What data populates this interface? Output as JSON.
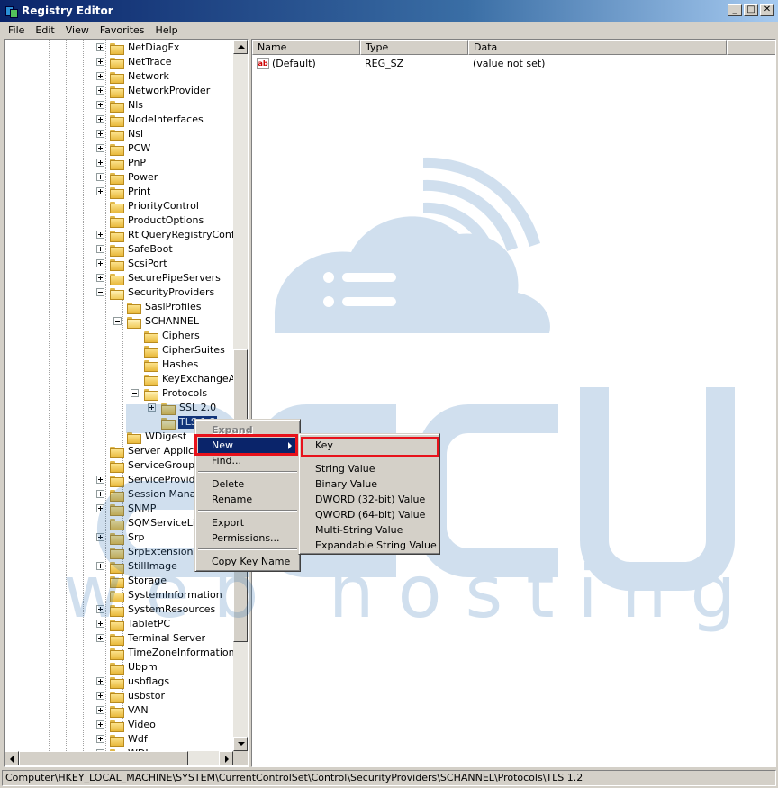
{
  "window": {
    "title": "Registry Editor",
    "minimize": "_",
    "maximize": "□",
    "close": "✕"
  },
  "menu": [
    "File",
    "Edit",
    "View",
    "Favorites",
    "Help"
  ],
  "tree": {
    "nodes": [
      {
        "label": "NetDiagFx",
        "level": 0,
        "expander": "plus"
      },
      {
        "label": "NetTrace",
        "level": 0,
        "expander": "plus"
      },
      {
        "label": "Network",
        "level": 0,
        "expander": "plus"
      },
      {
        "label": "NetworkProvider",
        "level": 0,
        "expander": "plus"
      },
      {
        "label": "Nls",
        "level": 0,
        "expander": "plus"
      },
      {
        "label": "NodeInterfaces",
        "level": 0,
        "expander": "plus"
      },
      {
        "label": "Nsi",
        "level": 0,
        "expander": "plus"
      },
      {
        "label": "PCW",
        "level": 0,
        "expander": "plus"
      },
      {
        "label": "PnP",
        "level": 0,
        "expander": "plus"
      },
      {
        "label": "Power",
        "level": 0,
        "expander": "plus"
      },
      {
        "label": "Print",
        "level": 0,
        "expander": "plus"
      },
      {
        "label": "PriorityControl",
        "level": 0,
        "expander": "none"
      },
      {
        "label": "ProductOptions",
        "level": 0,
        "expander": "none"
      },
      {
        "label": "RtlQueryRegistryConfig",
        "level": 0,
        "expander": "plus"
      },
      {
        "label": "SafeBoot",
        "level": 0,
        "expander": "plus"
      },
      {
        "label": "ScsiPort",
        "level": 0,
        "expander": "plus"
      },
      {
        "label": "SecurePipeServers",
        "level": 0,
        "expander": "plus"
      },
      {
        "label": "SecurityProviders",
        "level": 0,
        "expander": "minus"
      },
      {
        "label": "SaslProfiles",
        "level": 1,
        "expander": "none"
      },
      {
        "label": "SCHANNEL",
        "level": 1,
        "expander": "minus"
      },
      {
        "label": "Ciphers",
        "level": 2,
        "expander": "none"
      },
      {
        "label": "CipherSuites",
        "level": 2,
        "expander": "none"
      },
      {
        "label": "Hashes",
        "level": 2,
        "expander": "none"
      },
      {
        "label": "KeyExchangeAlgorithms",
        "level": 2,
        "expander": "none"
      },
      {
        "label": "Protocols",
        "level": 2,
        "expander": "minus"
      },
      {
        "label": "SSL 2.0",
        "level": 3,
        "expander": "plus"
      },
      {
        "label": "TLS 1.2",
        "level": 3,
        "expander": "none",
        "selected": true
      },
      {
        "label": "WDigest",
        "level": 1,
        "expander": "none"
      },
      {
        "label": "Server Applications",
        "level": 0,
        "expander": "none"
      },
      {
        "label": "ServiceGroupOrder",
        "level": 0,
        "expander": "none"
      },
      {
        "label": "ServiceProvider",
        "level": 0,
        "expander": "plus"
      },
      {
        "label": "Session Manager",
        "level": 0,
        "expander": "plus"
      },
      {
        "label": "SNMP",
        "level": 0,
        "expander": "plus"
      },
      {
        "label": "SQMServiceList",
        "level": 0,
        "expander": "none"
      },
      {
        "label": "Srp",
        "level": 0,
        "expander": "plus"
      },
      {
        "label": "SrpExtensionConfig",
        "level": 0,
        "expander": "none"
      },
      {
        "label": "StillImage",
        "level": 0,
        "expander": "plus"
      },
      {
        "label": "Storage",
        "level": 0,
        "expander": "none"
      },
      {
        "label": "SystemInformation",
        "level": 0,
        "expander": "none"
      },
      {
        "label": "SystemResources",
        "level": 0,
        "expander": "plus"
      },
      {
        "label": "TabletPC",
        "level": 0,
        "expander": "plus"
      },
      {
        "label": "Terminal Server",
        "level": 0,
        "expander": "plus"
      },
      {
        "label": "TimeZoneInformation",
        "level": 0,
        "expander": "none"
      },
      {
        "label": "Ubpm",
        "level": 0,
        "expander": "none"
      },
      {
        "label": "usbflags",
        "level": 0,
        "expander": "plus"
      },
      {
        "label": "usbstor",
        "level": 0,
        "expander": "plus"
      },
      {
        "label": "VAN",
        "level": 0,
        "expander": "plus"
      },
      {
        "label": "Video",
        "level": 0,
        "expander": "plus"
      },
      {
        "label": "Wdf",
        "level": 0,
        "expander": "plus"
      },
      {
        "label": "WDI",
        "level": 0,
        "expander": "plus"
      }
    ]
  },
  "list": {
    "columns": [
      "Name",
      "Type",
      "Data"
    ],
    "rows": [
      {
        "name": "(Default)",
        "type": "REG_SZ",
        "data": "(value not set)",
        "icon": "ab-string-icon"
      }
    ]
  },
  "context_menu": {
    "items": [
      {
        "label": "Expand",
        "type": "item",
        "disabled": true
      },
      {
        "label": "New",
        "type": "item",
        "highlighted": true,
        "submenu": true
      },
      {
        "label": "Find...",
        "type": "item"
      },
      {
        "type": "separator"
      },
      {
        "label": "Delete",
        "type": "item"
      },
      {
        "label": "Rename",
        "type": "item"
      },
      {
        "type": "separator"
      },
      {
        "label": "Export",
        "type": "item"
      },
      {
        "label": "Permissions...",
        "type": "item"
      },
      {
        "type": "separator"
      },
      {
        "label": "Copy Key Name",
        "type": "item"
      }
    ]
  },
  "submenu": {
    "items": [
      {
        "label": "Key",
        "type": "item"
      },
      {
        "type": "separator"
      },
      {
        "label": "String Value",
        "type": "item"
      },
      {
        "label": "Binary Value",
        "type": "item"
      },
      {
        "label": "DWORD (32-bit) Value",
        "type": "item"
      },
      {
        "label": "QWORD (64-bit) Value",
        "type": "item"
      },
      {
        "label": "Multi-String Value",
        "type": "item"
      },
      {
        "label": "Expandable String Value",
        "type": "item"
      }
    ]
  },
  "status": {
    "path": "Computer\\HKEY_LOCAL_MACHINE\\SYSTEM\\CurrentControlSet\\Control\\SecurityProviders\\SCHANNEL\\Protocols\\TLS 1.2"
  },
  "watermark": {
    "brand": "accu",
    "tagline": "web hosting",
    "color": "#2f73b6"
  },
  "colors": {
    "highlight": "#0a246a",
    "callout": "#e8121b",
    "chrome": "#d4d0c8"
  }
}
